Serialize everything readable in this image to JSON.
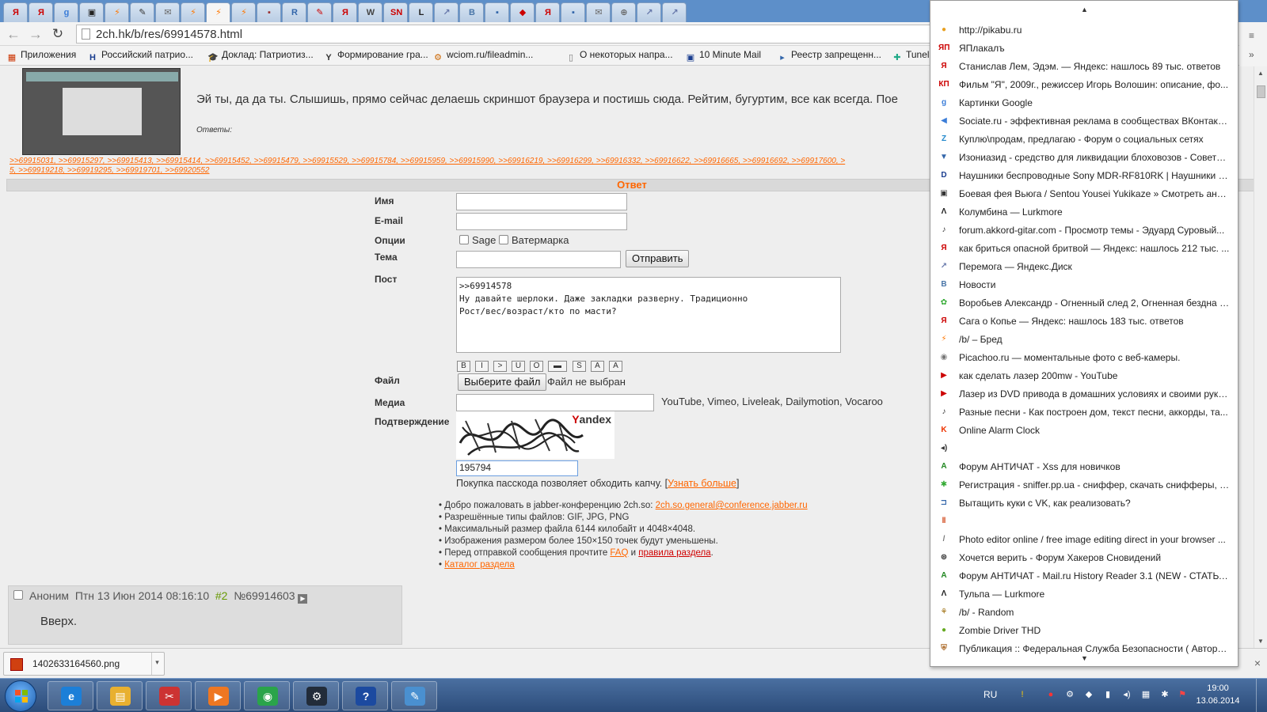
{
  "browser": {
    "url": "2ch.hk/b/res/69914578.html",
    "tabs": [
      {
        "icon": "Я",
        "color": "#cc0000",
        "active": false
      },
      {
        "icon": "Я",
        "color": "#cc0000",
        "active": false
      },
      {
        "icon": "g",
        "color": "#3b7dd8",
        "active": false
      },
      {
        "icon": "▣",
        "color": "#222222",
        "active": false
      },
      {
        "icon": "⚡",
        "color": "#ff7700",
        "active": false
      },
      {
        "icon": "✎",
        "color": "#333333",
        "active": false
      },
      {
        "icon": "✉",
        "color": "#666666",
        "active": false
      },
      {
        "icon": "⚡",
        "color": "#ff7700",
        "active": false
      },
      {
        "icon": "⚡",
        "color": "#ff7700",
        "active": true
      },
      {
        "icon": "⚡",
        "color": "#ff7700",
        "active": false
      },
      {
        "icon": "▪",
        "color": "#993333",
        "active": false
      },
      {
        "icon": "R",
        "color": "#3366aa",
        "active": false
      },
      {
        "icon": "✎",
        "color": "#cc0000",
        "active": false
      },
      {
        "icon": "Я",
        "color": "#cc0000",
        "active": false
      },
      {
        "icon": "W",
        "color": "#444444",
        "active": false
      },
      {
        "icon": "SN",
        "color": "#cc0000",
        "active": false
      },
      {
        "icon": "L",
        "color": "#222222",
        "active": false
      },
      {
        "icon": "↗",
        "color": "#6677aa",
        "active": false
      },
      {
        "icon": "B",
        "color": "#4a76a8",
        "active": false
      },
      {
        "icon": "▪",
        "color": "#3366aa",
        "active": false
      },
      {
        "icon": "◆",
        "color": "#cc0000",
        "active": false
      },
      {
        "icon": "Я",
        "color": "#cc0000",
        "active": false
      },
      {
        "icon": "▪",
        "color": "#3366aa",
        "active": false
      },
      {
        "icon": "✉",
        "color": "#666666",
        "active": false
      },
      {
        "icon": "⊕",
        "color": "#666666",
        "active": false
      },
      {
        "icon": "↗",
        "color": "#6677aa",
        "active": false
      },
      {
        "icon": "↗",
        "color": "#6677aa",
        "active": false
      }
    ],
    "bookmarks": [
      {
        "label": "Приложения",
        "icon": "▦",
        "color": "#cc3300"
      },
      {
        "label": "Российский патрио...",
        "icon": "H",
        "color": "#1a3d8f"
      },
      {
        "label": "Доклад: Патриотиз...",
        "icon": "🎓",
        "color": "#333333"
      },
      {
        "label": "Формирование гра...",
        "icon": "Y",
        "color": "#333333"
      },
      {
        "label": "wciom.ru/fileadmin...",
        "icon": "⚙",
        "color": "#cc6600"
      },
      {
        "label": "О некоторых напра...",
        "icon": "▯",
        "color": "#777777"
      },
      {
        "label": "10 Minute Mail",
        "icon": "▣",
        "color": "#1a3d8f"
      },
      {
        "label": "Реестр запрещенн...",
        "icon": "▸",
        "color": "#3366aa"
      },
      {
        "label": "Tunel",
        "icon": "✚",
        "color": "#22aa88"
      }
    ]
  },
  "thread": {
    "op_text": "Эй ты, да да ты. Слышишь, прямо сейчас делаешь скриншот браузера и постишь сюда. Рейтим, бугуртим, все как всегда. Пое",
    "replies_label": "Ответы:",
    "reflinks_line1": ">>69915031, >>69915297, >>69915413, >>69915414, >>69915452, >>69915479, >>69915529, >>69915784, >>69915959, >>69915990, >>69916219, >>69916299, >>69916332, >>69916622, >>69916665, >>69916692, >>69917600, >",
    "reflinks_line2": "5, >>69919218, >>69919295, >>69919701, >>69920552",
    "reply_header": "Ответ"
  },
  "form": {
    "name_label": "Имя",
    "email_label": "E-mail",
    "options_label": "Опции",
    "sage_label": "Sage",
    "watermark_label": "Ватермарка",
    "subject_label": "Тема",
    "submit_label": "Отправить",
    "post_label": "Пост",
    "post_value": ">>69914578\nНу давайте шерлоки. Даже закладки разверну. Традиционно\nРост/вес/возраст/кто по масти?",
    "format_buttons": [
      "B",
      "I",
      ">",
      "U",
      "O",
      "▬",
      "S",
      "A",
      "A"
    ],
    "file_label": "Файл",
    "choose_file_label": "Выберите файл",
    "no_file_label": "Файл не выбран",
    "media_label": "Медиа",
    "media_services": "YouTube, Vimeo, Liveleak, Dailymotion, Vocaroo",
    "captcha_label": "Подтверждение",
    "captcha_brand_y": "Y",
    "captcha_brand_rest": "andex",
    "captcha_value": "195794",
    "passcode_text": "Покупка пасскода позволяет обходить капчу.",
    "passcode_link": "Узнать больше",
    "rules": {
      "jabber_text": "Добро пожаловать в jabber-конференцию 2ch.so:",
      "jabber_link": "2ch.so.general@conference.jabber.ru",
      "types": "Разрешённые типы файлов: GIF, JPG, PNG",
      "max_size": "Максимальный размер файла 6144 килобайт и 4048×4048.",
      "thumbs": "Изображения размером более 150×150 точек будут уменьшены.",
      "before_text": "Перед отправкой сообщения прочтите",
      "faq_link": "FAQ",
      "and_text": "и",
      "rules_link": "правила раздела",
      "catalog_link": "Каталог раздела"
    }
  },
  "next_post": {
    "author": "Аноним",
    "date": "Птн 13 Июн 2014 08:16:10",
    "num_index": "#2",
    "post_id": "№69914603",
    "body": "Вверх."
  },
  "download": {
    "filename": "1402633164560.png"
  },
  "bookmark_menu": [
    {
      "label": "http://pikabu.ru",
      "icon": "●",
      "color": "#e8a020"
    },
    {
      "label": "ЯПлакалъ",
      "icon": "ЯП",
      "color": "#cc0000"
    },
    {
      "label": "Станислав Лем, Эдэм. — Яндекс: нашлось 89 тыс. ответов",
      "icon": "Я",
      "color": "#cc0000"
    },
    {
      "label": "Фильм \"Я\", 2009г., режиссер Игорь Волошин: описание, фо...",
      "icon": "КП",
      "color": "#cc0000"
    },
    {
      "label": "Картинки Google",
      "icon": "g",
      "color": "#3b7dd8"
    },
    {
      "label": "Sociate.ru - эффективная реклама в сообществах ВКонтакте...",
      "icon": "◀",
      "color": "#3b7dd8"
    },
    {
      "label": "Куплю\\продам, предлагаю - Форум о социальных сетях",
      "icon": "Z",
      "color": "#2288cc"
    },
    {
      "label": "Изониазид - средство для ликвидации блоховозов - Советы...",
      "icon": "▼",
      "color": "#3366aa"
    },
    {
      "label": "Наушники беспроводные Sony MDR-RF810RK | Наушники | ...",
      "icon": "D",
      "color": "#1a3d8f"
    },
    {
      "label": "Боевая фея Вьюга / Sentou Yousei Yukikaze » Смотреть аним...",
      "icon": "▣",
      "color": "#333333"
    },
    {
      "label": "Колумбина — Lurkmore",
      "icon": "Λ",
      "color": "#222222"
    },
    {
      "label": "forum.akkord-gitar.com - Просмотр темы - Эдуард Суровый...",
      "icon": "♪",
      "color": "#333333"
    },
    {
      "label": "как бриться опасной бритвой — Яндекс: нашлось 212 тыс. ...",
      "icon": "Я",
      "color": "#cc0000"
    },
    {
      "label": "Перемога — Яндекс.Диск",
      "icon": "↗",
      "color": "#6677aa"
    },
    {
      "label": "Новости",
      "icon": "B",
      "color": "#4a76a8"
    },
    {
      "label": "Воробьев Александр - Огненный след 2, Огненная бездна [...",
      "icon": "✿",
      "color": "#33aa33"
    },
    {
      "label": "Сага о Копье — Яндекс: нашлось 183 тыс. ответов",
      "icon": "Я",
      "color": "#cc0000"
    },
    {
      "label": "/b/ – Бред",
      "icon": "⚡",
      "color": "#ff7700"
    },
    {
      "label": "Picachoo.ru — моментальные фото с веб-камеры.",
      "icon": "◉",
      "color": "#777777"
    },
    {
      "label": "как сделать лазер 200mw - YouTube",
      "icon": "▶",
      "color": "#cc0000"
    },
    {
      "label": "Лазер из DVD привода в домашних условиях и своими рука...",
      "icon": "▶",
      "color": "#cc0000"
    },
    {
      "label": "Разные песни - Как построен дом, текст песни, аккорды, та...",
      "icon": "♪",
      "color": "#333333"
    },
    {
      "label": "Online Alarm Clock",
      "icon": "K",
      "color": "#ee3300"
    },
    {
      "label": "",
      "icon": "◂)",
      "color": "#333333"
    },
    {
      "label": "Форум АНТИЧАТ - Xss для новичков",
      "icon": "A",
      "color": "#228822"
    },
    {
      "label": "Регистрация - sniffer.pp.ua - сниффер, скачать снифферы, с...",
      "icon": "✱",
      "color": "#33aa33"
    },
    {
      "label": "Вытащить куки с VK, как реализовать?",
      "icon": "⊐",
      "color": "#3366aa"
    },
    {
      "label": "",
      "icon": "‖",
      "color": "#cc3300"
    },
    {
      "label": "Photo editor online / free image editing direct in your browser ...",
      "icon": "/",
      "color": "#777777"
    },
    {
      "label": "Хочется верить - Форум Хакеров Сновидений",
      "icon": "⊛",
      "color": "#222222"
    },
    {
      "label": "Форум АНТИЧАТ - Mail.ru History Reader 3.1 (NEW - СТАТЬЯ...",
      "icon": "A",
      "color": "#228822"
    },
    {
      "label": "Тульпа — Lurkmore",
      "icon": "Λ",
      "color": "#222222"
    },
    {
      "label": "/b/ - Random",
      "icon": "⚘",
      "color": "#996600"
    },
    {
      "label": "Zombie Driver THD",
      "icon": "●",
      "color": "#66aa22"
    },
    {
      "label": "Публикация :: Федеральная Служба Безопасности ( Авторс...",
      "icon": "⛨",
      "color": "#aa6622"
    }
  ],
  "taskbar": {
    "apps": [
      {
        "name": "ie",
        "icon": "e",
        "color": "#1c7fd8"
      },
      {
        "name": "explorer",
        "icon": "▤",
        "color": "#e8b030"
      },
      {
        "name": "snipping",
        "icon": "✂",
        "color": "#cc3333"
      },
      {
        "name": "media",
        "icon": "▶",
        "color": "#ee7722"
      },
      {
        "name": "chrome",
        "icon": "◉",
        "color": "#2aa44a"
      },
      {
        "name": "steam",
        "icon": "⚙",
        "color": "#222c3a"
      },
      {
        "name": "help",
        "icon": "?",
        "color": "#1c4aa0"
      },
      {
        "name": "paint",
        "icon": "✎",
        "color": "#4a90d0"
      }
    ],
    "lang": "RU",
    "time": "19:00",
    "date": "13.06.2014"
  }
}
